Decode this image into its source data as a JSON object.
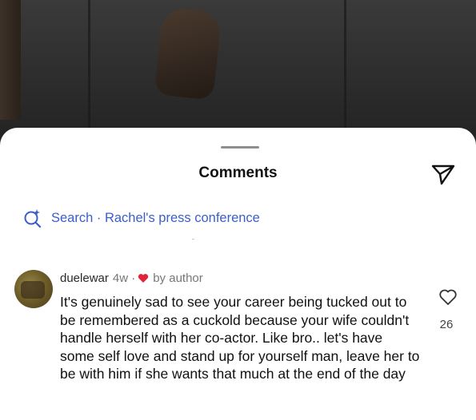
{
  "sheet": {
    "title": "Comments"
  },
  "search": {
    "label": "Search · Rachel's press conference"
  },
  "comment": {
    "username": "duelewar",
    "age": "4w ·",
    "badge": "by author",
    "text": "It's genuinely sad to see your career being tucked out to be remembered as a cuckold because your wife couldn't handle herself with her co-actor. Like bro.. let's have some self love and stand up for yourself man, leave her to be with him if she wants that much at the end of the day",
    "likes": "26"
  },
  "colors": {
    "accent": "#3a5fc9",
    "heart": "#e0243a"
  },
  "icons": [
    "send-icon",
    "search-sparkle-icon",
    "heart-icon",
    "heart-outline-icon"
  ]
}
